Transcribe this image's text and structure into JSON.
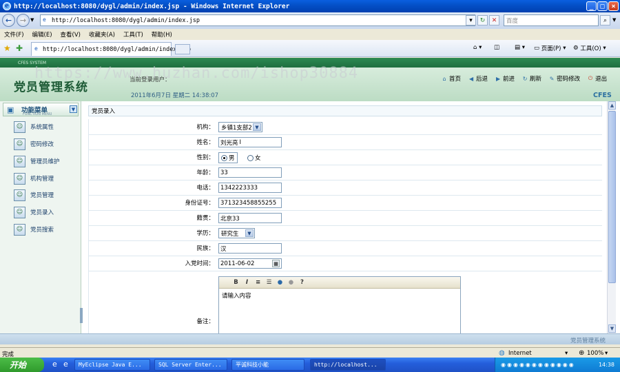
{
  "window": {
    "title": "http://localhost:8080/dygl/admin/index.jsp - Windows Internet Explorer"
  },
  "browser": {
    "address": "http://localhost:8080/dygl/admin/index.jsp",
    "search_placeholder": "百度",
    "menu": [
      "文件(F)",
      "编辑(E)",
      "查看(V)",
      "收藏夹(A)",
      "工具(T)",
      "帮助(H)"
    ],
    "tab_title": "http://localhost:8080/dygl/admin/index.jsp",
    "page_menu": "页面(P)",
    "tools_menu": "工具(O)"
  },
  "header": {
    "small_title": "CFES SYSTEM",
    "title": "党员管理系统",
    "user_info": "当前登录用户：",
    "datetime": "2011年6月7日 星期二 14:38:07",
    "brand": "CFES",
    "watermark": "https://www.huzhan.com/ishop30884",
    "links": [
      {
        "label": "首页",
        "icon": "home-icon"
      },
      {
        "label": "后退",
        "icon": "back-icon"
      },
      {
        "label": "前进",
        "icon": "forward-icon"
      },
      {
        "label": "刷新",
        "icon": "refresh-icon"
      },
      {
        "label": "密码修改",
        "icon": "key-icon"
      },
      {
        "label": "退出",
        "icon": "exit-icon"
      }
    ]
  },
  "sidebar": {
    "title": "功能菜单",
    "subtitle": "FUNCTION MENU",
    "items": [
      "系统属性",
      "密码修改",
      "管理员维护",
      "机构管理",
      "党员管理",
      "党员录入",
      "党员搜索"
    ]
  },
  "form": {
    "heading": "党员录入",
    "fields": {
      "org": {
        "label": "机构：",
        "value": "乡镇1支部2"
      },
      "name": {
        "label": "姓名：",
        "value": "刘光亮"
      },
      "gender": {
        "label": "性别：",
        "options": [
          "男",
          "女"
        ],
        "selected": "男"
      },
      "age": {
        "label": "年龄：",
        "value": "33"
      },
      "phone": {
        "label": "电话：",
        "value": "1342223333"
      },
      "idcard": {
        "label": "身份证号：",
        "value": "371323458855255"
      },
      "hometown": {
        "label": "籍贯：",
        "value": "北京33"
      },
      "education": {
        "label": "学历：",
        "value": "研究生"
      },
      "ethnicity": {
        "label": "民族：",
        "value": "汉"
      },
      "join_date": {
        "label": "入党时间：",
        "value": "2011-06-02"
      },
      "remark": {
        "label": "备注：",
        "placeholder": "请输入内容"
      }
    }
  },
  "page_footer": "党员管理系统",
  "status": {
    "left": "完成",
    "zone": "Internet",
    "zoom": "100%"
  },
  "taskbar": {
    "start": "开始",
    "tasks": [
      "MyEclipse Java E...",
      "SQL Server Enter...",
      "平诚科技小能",
      "http://localhost..."
    ],
    "clock": "14:38"
  }
}
